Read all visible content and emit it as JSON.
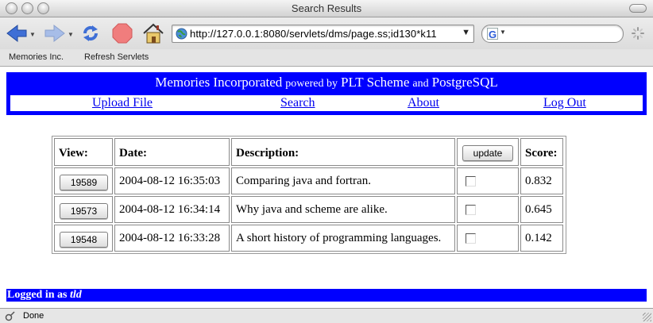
{
  "window": {
    "title": "Search Results"
  },
  "toolbar": {
    "url": "http://127.0.0.1:8080/servlets/dms/page.ss;id130*k11",
    "search_placeholder": ""
  },
  "bookmarks": [
    "Memories Inc.",
    "Refresh Servlets"
  ],
  "banner": {
    "title_big1": "Memories Incorporated",
    "title_small1": "powered by",
    "title_big2": "PLT Scheme",
    "title_small2": "and",
    "title_big3": "PostgreSQL"
  },
  "nav": {
    "upload": "Upload File",
    "search": "Search",
    "about": "About",
    "logout": "Log Out"
  },
  "table": {
    "headers": {
      "view": "View:",
      "date": "Date:",
      "description": "Description:",
      "update": "update",
      "score": "Score:"
    },
    "rows": [
      {
        "id": "19589",
        "date": "2004-08-12 16:35:03",
        "description": "Comparing java and fortran.",
        "checked": false,
        "score": "0.832"
      },
      {
        "id": "19573",
        "date": "2004-08-12 16:34:14",
        "description": "Why java and scheme are alike.",
        "checked": false,
        "score": "0.645"
      },
      {
        "id": "19548",
        "date": "2004-08-12 16:33:28",
        "description": "A short history of programming languages.",
        "checked": false,
        "score": "0.142"
      }
    ]
  },
  "footer": {
    "logged_in_label": "Logged in as",
    "user": "tld"
  },
  "status": {
    "text": "Done"
  },
  "colors": {
    "banner_blue": "#0000ff",
    "link_blue": "#0000ee"
  }
}
